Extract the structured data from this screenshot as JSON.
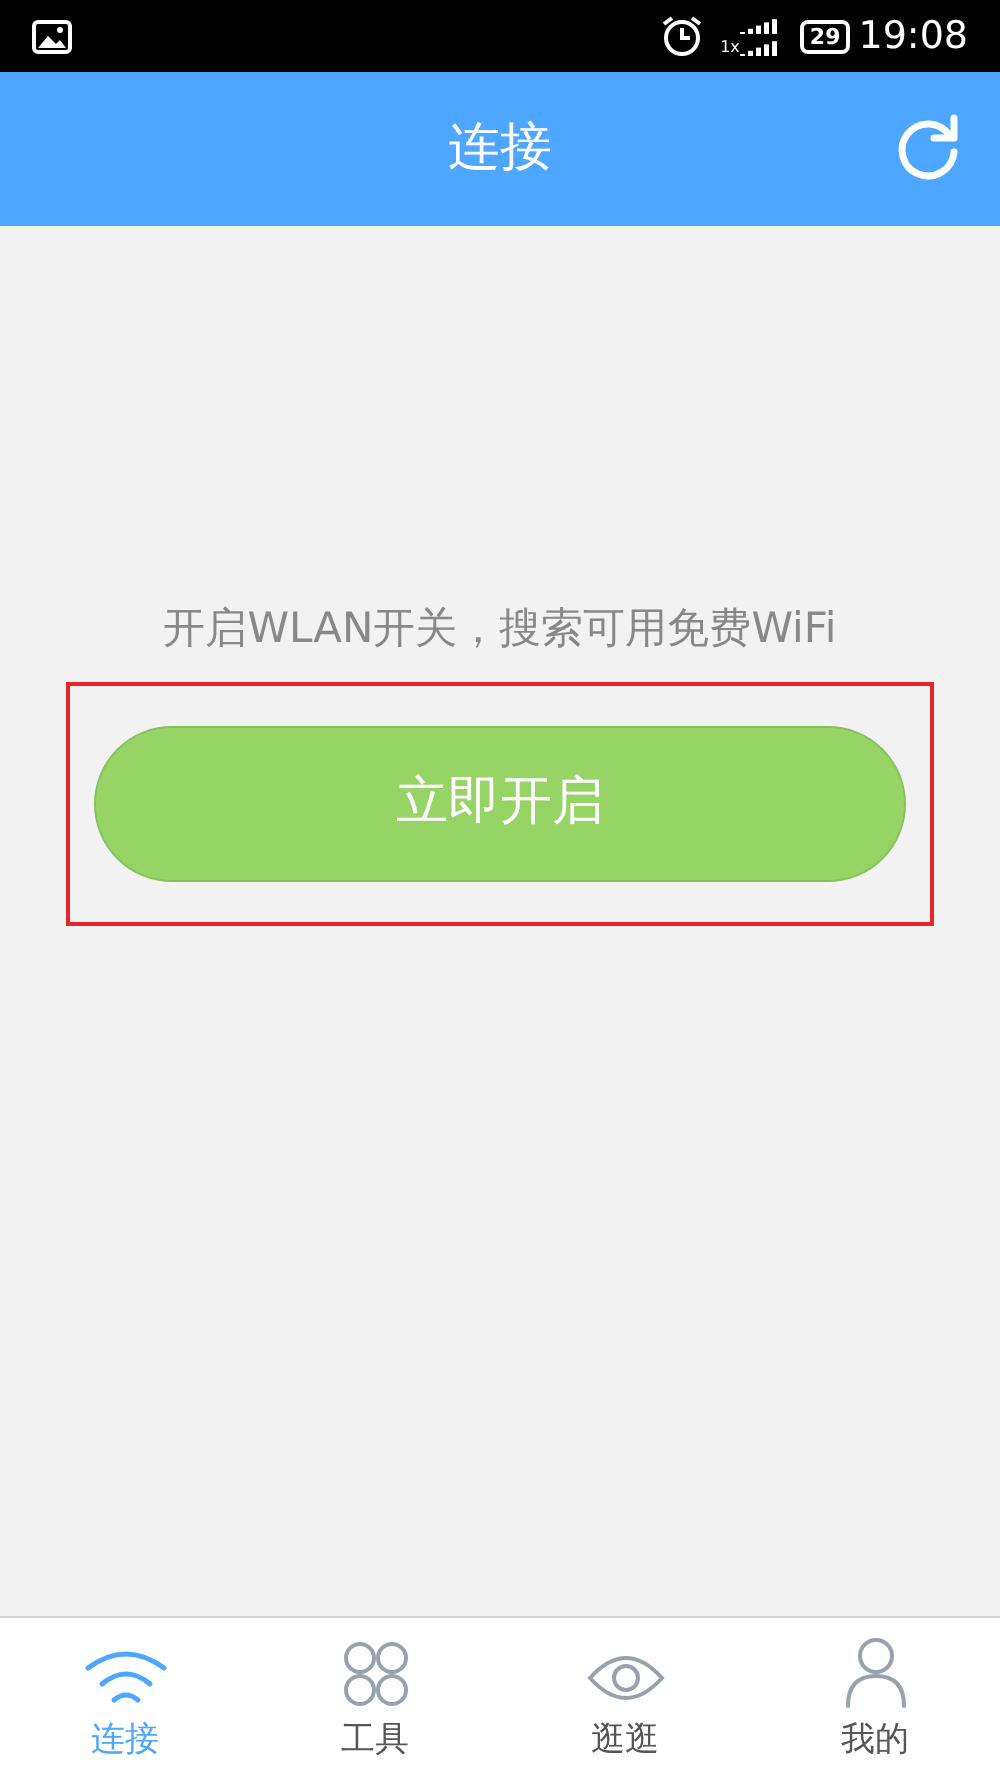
{
  "status_bar": {
    "battery": "29",
    "time": "19:08",
    "network": "1x"
  },
  "header": {
    "title": "连接"
  },
  "prompt": "开启WLAN开关，搜索可用免费WiFi",
  "action_button": {
    "label": "立即开启",
    "highlighted": true
  },
  "bottom_nav": [
    {
      "kind": "wifi",
      "label": "连接",
      "selected": true
    },
    {
      "kind": "tools",
      "label": "工具",
      "selected": false
    },
    {
      "kind": "eye",
      "label": "逛逛",
      "selected": false
    },
    {
      "kind": "person",
      "label": "我的",
      "selected": false
    }
  ]
}
